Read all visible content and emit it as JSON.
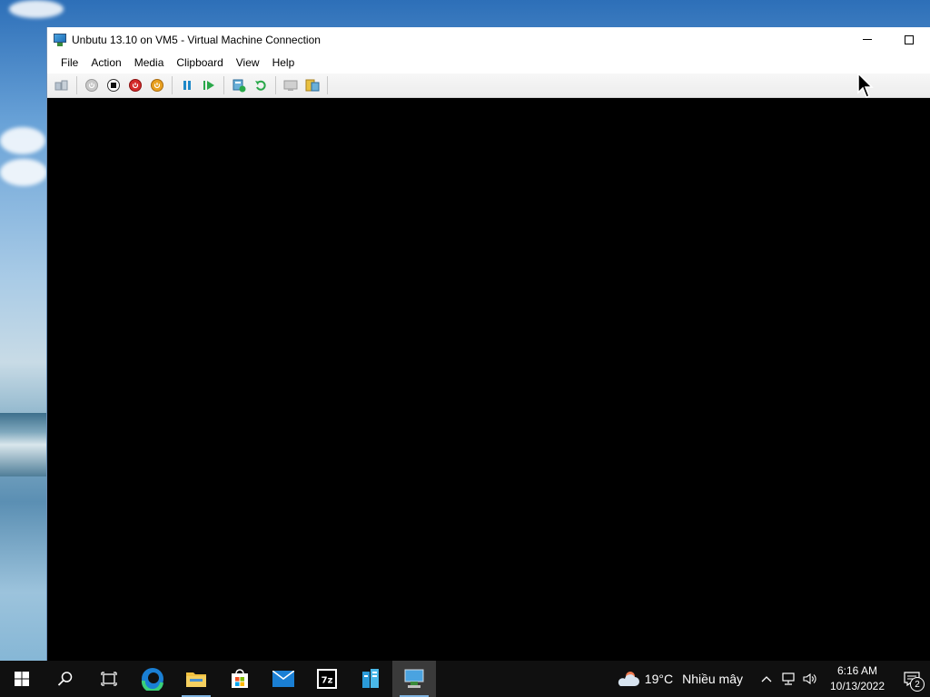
{
  "window": {
    "title": "Unbutu 13.10 on VM5 - Virtual Machine Connection"
  },
  "menu": [
    "File",
    "Action",
    "Media",
    "Clipboard",
    "View",
    "Help"
  ],
  "toolbar": {
    "icons": [
      "ctrl-alt-del-icon",
      "start-icon",
      "turn-off-icon",
      "shutdown-icon",
      "save-icon",
      "pause-icon",
      "resume-icon",
      "checkpoint-icon",
      "revert-icon",
      "enhanced-session-icon",
      "share-icon"
    ]
  },
  "taskbar": {
    "weather": {
      "temp": "19°C",
      "condition": "Nhiều mây"
    },
    "clock": {
      "time": "6:16 AM",
      "date": "10/13/2022"
    },
    "notifications": "2"
  },
  "colors": {
    "taskbar": "#101010",
    "vm_screen": "#000000",
    "active_task_underline": "#7fb3e0"
  }
}
